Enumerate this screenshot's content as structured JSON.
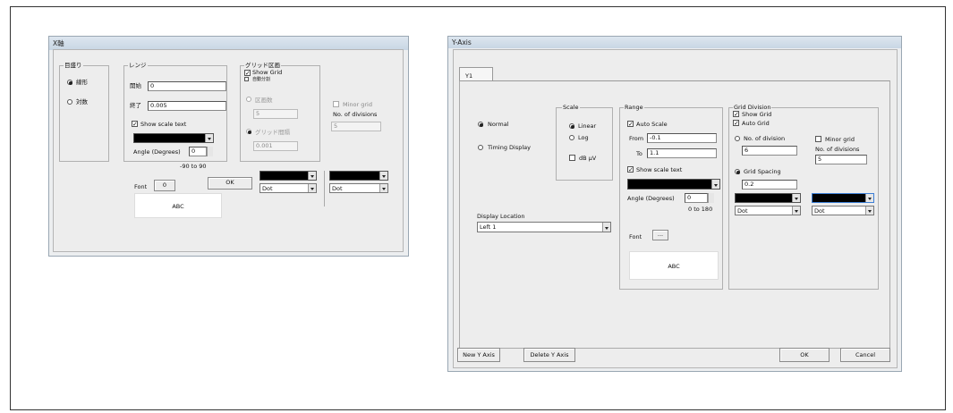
{
  "dialog_x": {
    "title": "X軸",
    "scale_group": {
      "legend": "目盛り",
      "option_linear": "線形",
      "option_log": "対数"
    },
    "range_group": {
      "legend": "レンジ",
      "from_label": "開始",
      "from_value": "0",
      "to_label": "終了",
      "to_value": "0.005",
      "show_scale_text": "Show scale text",
      "angle_label": "Angle (Degrees)",
      "angle_value": "0",
      "angle_hint": "-90 to 90"
    },
    "grid_group": {
      "legend": "グリッド区画",
      "show_grid": "Show Grid",
      "auto_grid": "自動分割",
      "option_divisions": "区画数",
      "divisions_value": "5",
      "option_spacing": "グリッド間隔",
      "spacing_value": "0.001",
      "minor_grid": "Minor grid",
      "no_of_divisions": "No. of divisions",
      "minor_value": "5",
      "line_style_1": "Dot",
      "line_style_2": "Dot"
    },
    "font_label": "Font",
    "font_button": "0",
    "preview_text": "ABC",
    "ok_button": "OK"
  },
  "dialog_y": {
    "title": "Y-Axis",
    "tab_label": "Y1",
    "mode_options": {
      "normal": "Normal",
      "timing": "Timing Display"
    },
    "scale_group": {
      "legend": "Scale",
      "linear": "Linear",
      "log": "Log",
      "db": "dB μV"
    },
    "range_group": {
      "legend": "Range",
      "auto_scale": "Auto Scale",
      "from_label": "From",
      "from_value": "-0.1",
      "to_label": "To",
      "to_value": "1.1",
      "show_scale_text": "Show scale text",
      "angle_label": "Angle (Degrees)",
      "angle_value": "0",
      "angle_hint": "0 to 180",
      "font_label": "Font",
      "font_button": "...",
      "preview_text": "ABC"
    },
    "grid_group": {
      "legend": "Grid Division",
      "show_grid": "Show Grid",
      "auto_grid": "Auto Grid",
      "no_of_division": "No. of division",
      "division_value": "6",
      "grid_spacing": "Grid Spacing",
      "spacing_value": "0.2",
      "minor_grid": "Minor grid",
      "no_of_divisions": "No. of divisions",
      "minor_value": "5",
      "line_style_1": "Dot",
      "line_style_2": "Dot"
    },
    "display_location_label": "Display Location",
    "display_location_value": "Left 1",
    "buttons": {
      "new": "New Y Axis",
      "delete": "Delete Y Axis",
      "ok": "OK",
      "cancel": "Cancel"
    }
  }
}
